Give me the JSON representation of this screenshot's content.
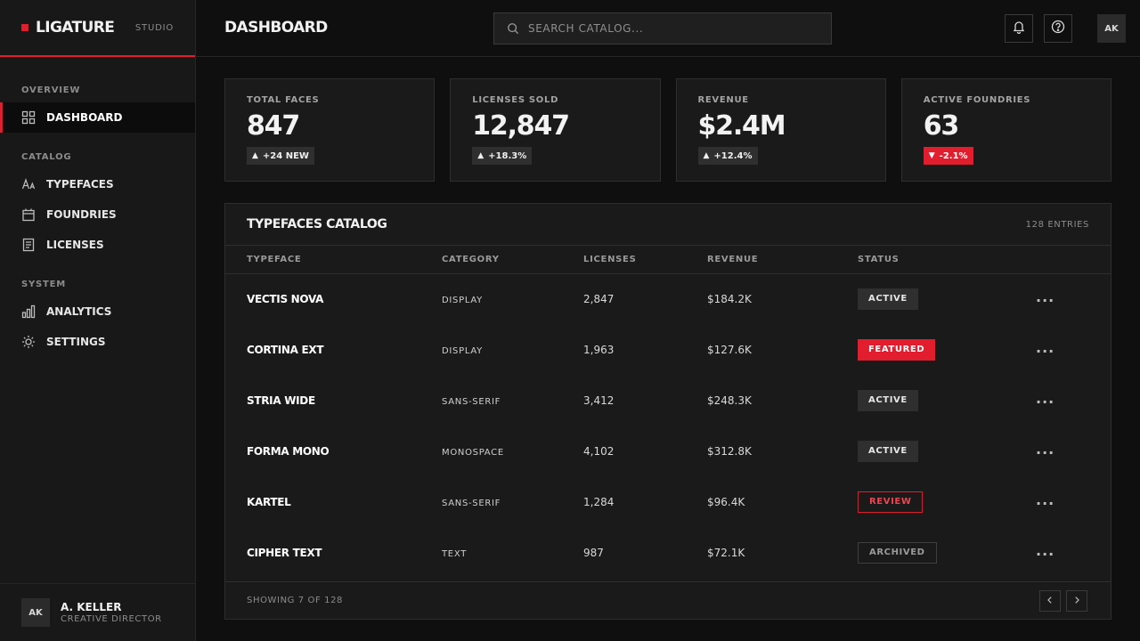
{
  "brand": {
    "name": "LIGATURE",
    "sub": "STUDIO",
    "accent": "#e11d2e"
  },
  "sidebar": {
    "sections": [
      {
        "heading": "OVERVIEW",
        "items": [
          {
            "label": "DASHBOARD",
            "icon": "grid-icon",
            "active": true
          }
        ]
      },
      {
        "heading": "CATALOG",
        "items": [
          {
            "label": "TYPEFACES",
            "icon": "type-icon"
          },
          {
            "label": "FOUNDRIES",
            "icon": "building-icon"
          },
          {
            "label": "LICENSES",
            "icon": "document-icon"
          }
        ]
      },
      {
        "heading": "SYSTEM",
        "items": [
          {
            "label": "ANALYTICS",
            "icon": "bar-chart-icon"
          },
          {
            "label": "SETTINGS",
            "icon": "gear-icon"
          }
        ]
      }
    ],
    "user": {
      "initials": "AK",
      "name": "A. KELLER",
      "role": "CREATIVE DIRECTOR"
    }
  },
  "header": {
    "title": "DASHBOARD",
    "search_placeholder": "SEARCH CATALOG...",
    "avatar": "AK"
  },
  "stats": [
    {
      "label": "TOTAL FACES",
      "value": "847",
      "delta": "+24 NEW",
      "direction": "up"
    },
    {
      "label": "LICENSES SOLD",
      "value": "12,847",
      "delta": "+18.3%",
      "direction": "up"
    },
    {
      "label": "REVENUE",
      "value": "$2.4M",
      "delta": "+12.4%",
      "direction": "up"
    },
    {
      "label": "ACTIVE FOUNDRIES",
      "value": "63",
      "delta": "-2.1%",
      "direction": "down"
    }
  ],
  "catalog": {
    "title": "TYPEFACES CATALOG",
    "count": "128 ENTRIES",
    "columns": [
      "TYPEFACE",
      "CATEGORY",
      "LICENSES",
      "REVENUE",
      "STATUS"
    ],
    "rows": [
      {
        "name": "VECTIS NOVA",
        "category": "DISPLAY",
        "licenses": "2,847",
        "revenue": "$184.2K",
        "status": "ACTIVE",
        "status_type": "active"
      },
      {
        "name": "CORTINA EXT",
        "category": "DISPLAY",
        "licenses": "1,963",
        "revenue": "$127.6K",
        "status": "FEATURED",
        "status_type": "featured"
      },
      {
        "name": "STRIA WIDE",
        "category": "SANS-SERIF",
        "licenses": "3,412",
        "revenue": "$248.3K",
        "status": "ACTIVE",
        "status_type": "active"
      },
      {
        "name": "FORMA MONO",
        "category": "MONOSPACE",
        "licenses": "4,102",
        "revenue": "$312.8K",
        "status": "ACTIVE",
        "status_type": "active"
      },
      {
        "name": "KARTEL",
        "category": "SANS-SERIF",
        "licenses": "1,284",
        "revenue": "$96.4K",
        "status": "REVIEW",
        "status_type": "review"
      },
      {
        "name": "CIPHER TEXT",
        "category": "TEXT",
        "licenses": "987",
        "revenue": "$72.1K",
        "status": "ARCHIVED",
        "status_type": "archived"
      }
    ],
    "footer": "SHOWING 7 OF 128",
    "row_action_icon": "more-horizontal-icon",
    "pager_icons": [
      "chevron-left-icon",
      "chevron-right-icon"
    ]
  },
  "header_icons": [
    "bell-icon",
    "help-icon"
  ]
}
